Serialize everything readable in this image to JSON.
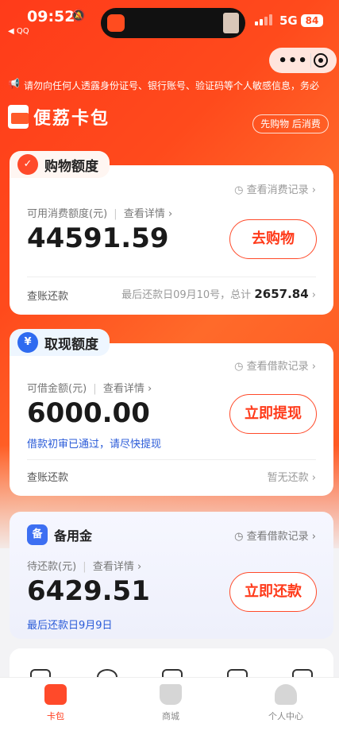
{
  "status_bar": {
    "time": "09:52",
    "back_app": "◀ QQ",
    "network": "5G",
    "battery": "84"
  },
  "notice": {
    "text": "请勿向任何人透露身份证号、银行账号、验证码等个人敏感信息，务必"
  },
  "brand": {
    "name": "便荔卡包",
    "slogan": "先购物 后消费"
  },
  "shopping": {
    "title": "购物额度",
    "record_link": "查看消费记录",
    "label": "可用消费额度(元)",
    "detail_link": "查看详情",
    "amount": "44591.59",
    "button": "去购物",
    "foot_left": "查账还款",
    "foot_right_prefix": "最后还款日09月10号，总计",
    "foot_right_amount": "2657.84"
  },
  "cash": {
    "title": "取现额度",
    "record_link": "查看借款记录",
    "label": "可借金额(元)",
    "detail_link": "查看详情",
    "amount": "6000.00",
    "button": "立即提现",
    "note": "借款初审已通过，请尽快提现",
    "foot_left": "查账还款",
    "foot_right": "暂无还款"
  },
  "reserve": {
    "title": "备用金",
    "record_link": "查看借款记录",
    "label": "待还款(元)",
    "detail_link": "查看详情",
    "amount": "6429.51",
    "button": "立即还款",
    "note": "最后还款日9月9日"
  },
  "tabbar": {
    "items": [
      {
        "label": "卡包",
        "icon": "wallet-icon"
      },
      {
        "label": "商城",
        "icon": "cart-icon"
      },
      {
        "label": "个人中心",
        "icon": "user-icon"
      }
    ],
    "active_color": "#ff3a1a"
  }
}
